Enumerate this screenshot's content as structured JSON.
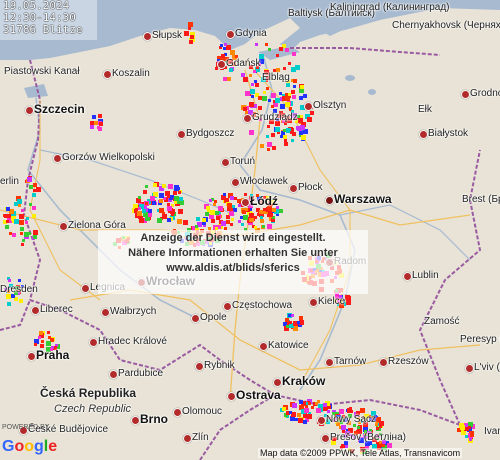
{
  "info": {
    "date": "19.05.2024",
    "time_range": "12:30-14:30",
    "count": "31786 Blitze"
  },
  "notice": {
    "line1": "Anzeige der Dienst wird eingestellt.",
    "line2": "Nähere Informationen erhalten Sie unter",
    "line3": "www.aldis.at/blids/sferics"
  },
  "places": [
    {
      "id": "gdynia",
      "label": "Gdynia"
    },
    {
      "id": "baltiysk",
      "label": "Baltiysk (Балтийск)"
    },
    {
      "id": "kaliningrad",
      "label": "Kaliningrad (Калининград)"
    },
    {
      "id": "chernyakhovsk",
      "label": "Chernyakhovsk (Черняховск)"
    },
    {
      "id": "slupsk",
      "label": "Słupsk"
    },
    {
      "id": "koszalin",
      "label": "Koszalin"
    },
    {
      "id": "gdansk",
      "label": "Gdańsk"
    },
    {
      "id": "elblag",
      "label": "Elbląg"
    },
    {
      "id": "olsztyn",
      "label": "Olsztyn"
    },
    {
      "id": "elk",
      "label": "Ełk"
    },
    {
      "id": "grodno",
      "label": "Grodno"
    },
    {
      "id": "piastowski",
      "label": "Piastowski Kanał"
    },
    {
      "id": "szczecin",
      "label": "Szczecin"
    },
    {
      "id": "bydgoszcz",
      "label": "Bydgoszcz"
    },
    {
      "id": "grudziadz",
      "label": "Grudziądz"
    },
    {
      "id": "bialystok",
      "label": "Białystok"
    },
    {
      "id": "gorzow",
      "label": "Gorzów Wielkopolski"
    },
    {
      "id": "torun",
      "label": "Toruń"
    },
    {
      "id": "berlin",
      "label": "erlin"
    },
    {
      "id": "wloclawek",
      "label": "Włocławek"
    },
    {
      "id": "plock",
      "label": "Płock"
    },
    {
      "id": "lodz",
      "label": "Łódź"
    },
    {
      "id": "warszawa",
      "label": "Warszawa"
    },
    {
      "id": "brest",
      "label": "Brest (Брэст)"
    },
    {
      "id": "zielona",
      "label": "Zielona Góra"
    },
    {
      "id": "radom",
      "label": "Radom"
    },
    {
      "id": "lublin",
      "label": "Lublin"
    },
    {
      "id": "legnica",
      "label": "Legnica"
    },
    {
      "id": "wroclaw",
      "label": "Wrocław"
    },
    {
      "id": "kielce",
      "label": "Kielce"
    },
    {
      "id": "dresden",
      "label": "Dresden"
    },
    {
      "id": "liberec",
      "label": "Liberec"
    },
    {
      "id": "walbrzych",
      "label": "Wałbrzych"
    },
    {
      "id": "opole",
      "label": "Opole"
    },
    {
      "id": "czestochowa",
      "label": "Częstochowa"
    },
    {
      "id": "zamosc",
      "label": "Zamość"
    },
    {
      "id": "hradec",
      "label": "Hradec Králové"
    },
    {
      "id": "katowice",
      "label": "Katowice"
    },
    {
      "id": "praha",
      "label": "Praha"
    },
    {
      "id": "rybnik",
      "label": "Rybnik"
    },
    {
      "id": "tarnow",
      "label": "Tarnów"
    },
    {
      "id": "rzeszow",
      "label": "Rzeszów"
    },
    {
      "id": "peresyp",
      "label": "Peresyp (Пересып)"
    },
    {
      "id": "pardubice",
      "label": "Pardubice"
    },
    {
      "id": "ostrava",
      "label": "Ostrava"
    },
    {
      "id": "krakow",
      "label": "Kraków"
    },
    {
      "id": "lviv",
      "label": "L'viv (Львів)"
    },
    {
      "id": "cesko",
      "label": "Česká Republika"
    },
    {
      "id": "czechrep",
      "label": "Czech Republic"
    },
    {
      "id": "olomouc",
      "label": "Olomouc"
    },
    {
      "id": "brno",
      "label": "Brno"
    },
    {
      "id": "ceske",
      "label": "České Budějovice"
    },
    {
      "id": "zlin",
      "label": "Zlín"
    },
    {
      "id": "nowysacz",
      "label": "Nowy Sącz"
    },
    {
      "id": "presov",
      "label": "Prešov (Ветліна)"
    },
    {
      "id": "ivano",
      "label": "Ivano-"
    }
  ],
  "copyright": "Map data ©2009 PPWK, Tele Atlas, Transnavicom",
  "logo": {
    "text": "Google",
    "powered": "POWERED BY"
  },
  "colors": {
    "sea": "#a7bad0",
    "land": "#e8e3d6",
    "border": "#8a4f8f",
    "strike_red": "#ff1a1a",
    "strike_purple": "#cc33ff",
    "strike_blue": "#2233ff"
  }
}
